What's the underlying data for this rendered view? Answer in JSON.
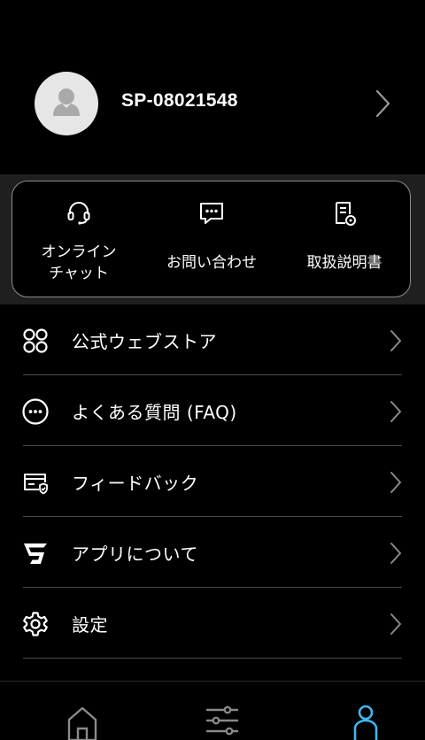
{
  "profile": {
    "user_id": "SP-08021548"
  },
  "quick_actions": [
    {
      "label": "オンライン\nチャット",
      "icon": "headset-icon"
    },
    {
      "label": "お問い合わせ",
      "icon": "chat-bubble-icon"
    },
    {
      "label": "取扱説明書",
      "icon": "manual-icon"
    }
  ],
  "menu": [
    {
      "label": "公式ウェブストア",
      "icon": "store-grid-icon"
    },
    {
      "label": "よくある質問 (FAQ)",
      "icon": "faq-dots-icon"
    },
    {
      "label": "フィードバック",
      "icon": "feedback-icon"
    },
    {
      "label": "アプリについて",
      "icon": "app-logo-icon"
    },
    {
      "label": "設定",
      "icon": "gear-icon"
    }
  ],
  "tabbar": {
    "items": [
      "home",
      "controls",
      "profile"
    ],
    "active": "profile",
    "active_color": "#3fb6f2",
    "inactive_color": "#8a8a8a"
  }
}
